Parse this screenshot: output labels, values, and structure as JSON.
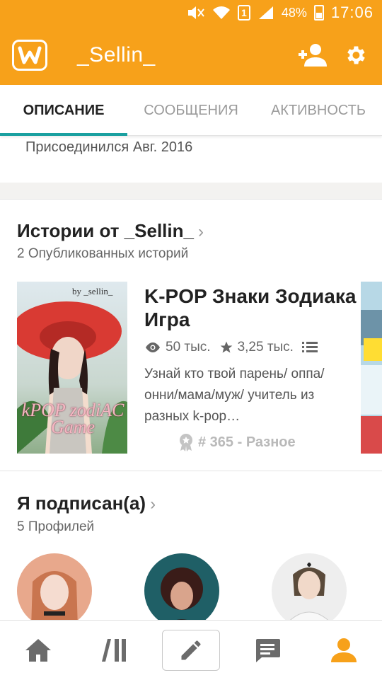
{
  "status_bar": {
    "sim_slot": "1",
    "battery_percent": "48%",
    "battery_level": 0.48,
    "time": "17:06",
    "icons": [
      "mute-icon",
      "wifi-icon",
      "sim-icon",
      "signal-icon",
      "battery-icon"
    ]
  },
  "app_bar": {
    "logo_icon": "wattpad-logo",
    "title": "_Sellin_",
    "actions": [
      "add-person-icon",
      "gear-icon"
    ]
  },
  "tabs": [
    {
      "label": "ОПИСАНИЕ",
      "active": true
    },
    {
      "label": "СООБЩЕНИЯ",
      "active": false
    },
    {
      "label": "АКТИВНОСТЬ",
      "active": false
    }
  ],
  "profile": {
    "joined": "Присоединился Авг. 2016"
  },
  "stories": {
    "title": "Истории от _Sellin_",
    "chevron": "›",
    "subtitle": "2 Опубликованных историй",
    "item": {
      "cover_text_author": "by _sellin_",
      "cover_text_main": "kPOP zodiAC Game",
      "title": "K-POP Знаки Зодиака  Игра",
      "views": "50 тыс.",
      "votes": "3,25 тыс.",
      "description": "Узнай  кто твой парень/ оппа/онни/мама/муж/ учитель из разных k-pop…",
      "rank": "# 365 - Разное"
    }
  },
  "following": {
    "title": "Я подписан(а)",
    "chevron": "›",
    "subtitle": "5 Профилей"
  },
  "bottom_nav": [
    "home-icon",
    "library-icon",
    "write-icon",
    "messages-icon",
    "profile-icon"
  ],
  "colors": {
    "brand": "#f7a11a",
    "tab_indicator": "#1aa0a0",
    "nav_icon": "#6b6b6b",
    "nav_active": "#f7a11a"
  }
}
